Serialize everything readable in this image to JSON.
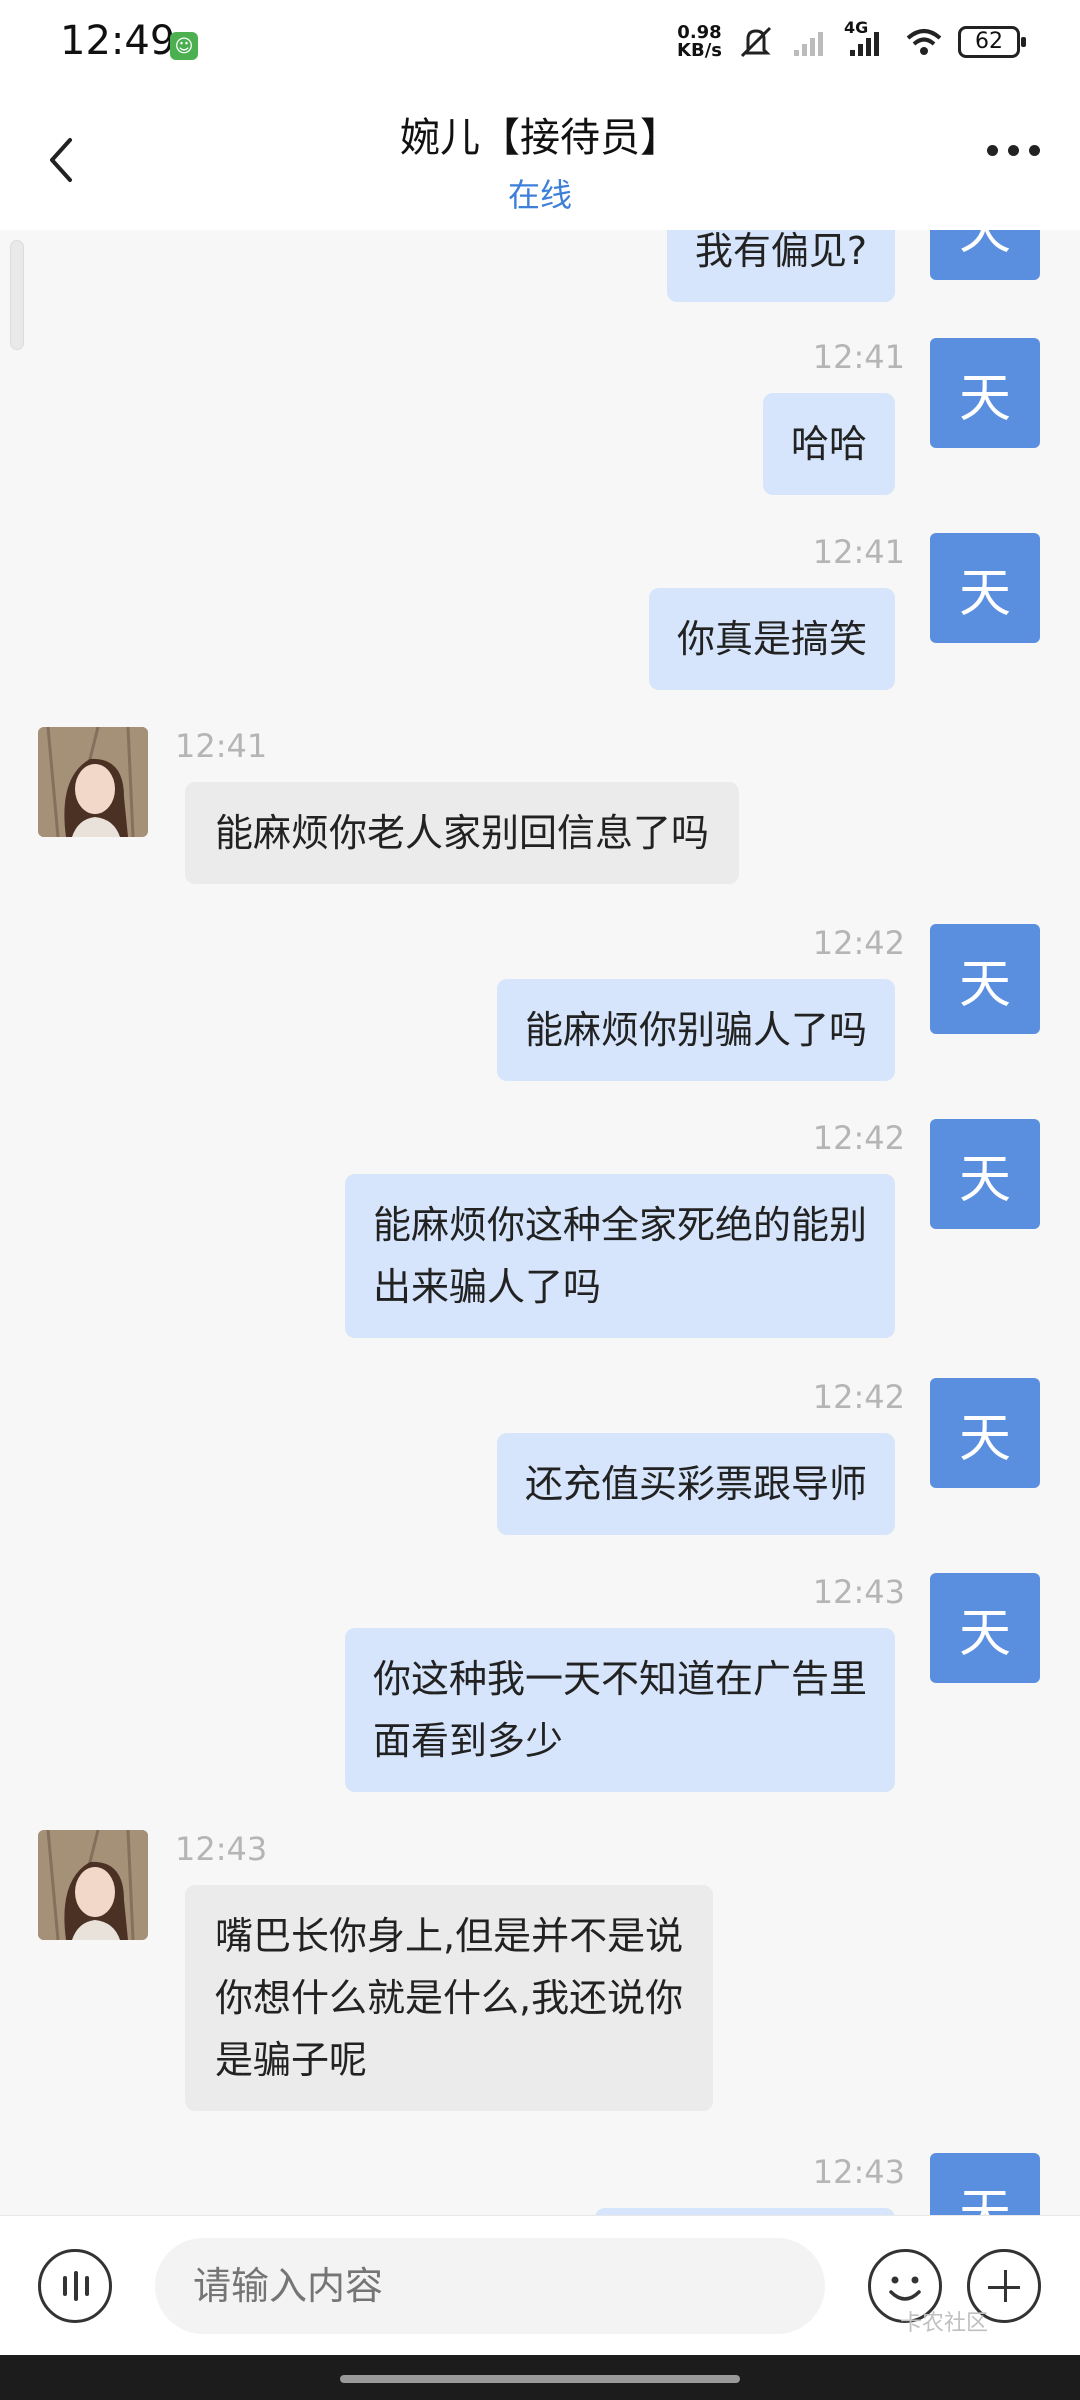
{
  "status_bar": {
    "time": "12:49",
    "net_speed": "0.98",
    "net_unit": "KB/s",
    "network_type": "4G",
    "battery": "62"
  },
  "header": {
    "title": "婉儿【接待员】",
    "status": "在线"
  },
  "my_avatar_text": "天",
  "messages": [
    {
      "from": "me",
      "time": "",
      "text": "我有偏见?"
    },
    {
      "from": "me",
      "time": "12:41",
      "text": "哈哈"
    },
    {
      "from": "me",
      "time": "12:41",
      "text": "你真是搞笑"
    },
    {
      "from": "her",
      "time": "12:41",
      "text": "能麻烦你老人家别回信息了吗"
    },
    {
      "from": "me",
      "time": "12:42",
      "text": "能麻烦你别骗人了吗"
    },
    {
      "from": "me",
      "time": "12:42",
      "text_lines": [
        "能麻烦你这种全家死绝的能别",
        "出来骗人了吗"
      ]
    },
    {
      "from": "me",
      "time": "12:42",
      "text": "还充值买彩票跟导师"
    },
    {
      "from": "me",
      "time": "12:43",
      "text_lines": [
        "你这种我一天不知道在广告里",
        "面看到多少"
      ]
    },
    {
      "from": "her",
      "time": "12:43",
      "text_lines": [
        "嘴巴长你身上,但是并不是说",
        "你想什么就是什么,我还说你",
        "是骗子呢"
      ]
    },
    {
      "from": "me",
      "time": "12:43",
      "text": ""
    }
  ],
  "input": {
    "placeholder": "请输入内容"
  },
  "watermark": "卡农社区"
}
